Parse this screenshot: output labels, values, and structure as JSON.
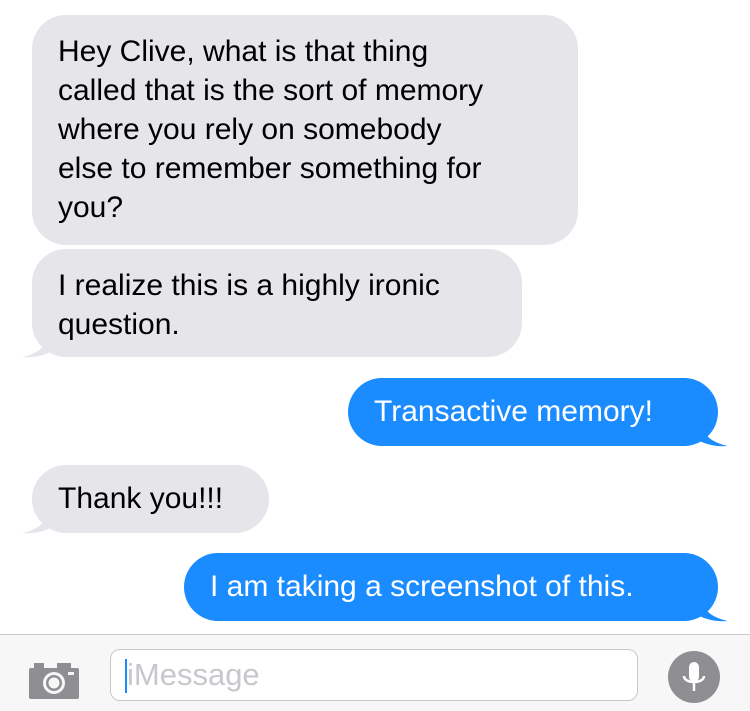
{
  "messages": [
    {
      "direction": "incoming",
      "text": "Hey Clive, what is that thing\ncalled that is the sort of memory\nwhere you rely on somebody\nelse to remember something for\nyou?"
    },
    {
      "direction": "incoming",
      "text": "I realize this is a highly ironic\nquestion."
    },
    {
      "direction": "outgoing",
      "text": "Transactive memory!"
    },
    {
      "direction": "incoming",
      "text": "Thank you!!!"
    },
    {
      "direction": "outgoing",
      "text": "I am taking a screenshot of this."
    }
  ],
  "composer": {
    "placeholder": "iMessage",
    "value": "",
    "camera_icon": "camera-icon",
    "mic_icon": "microphone-icon"
  },
  "colors": {
    "incoming_bubble": "#e5e5ea",
    "outgoing_bubble": "#1a8cff",
    "toolbar_bg": "#f7f7f8",
    "mic_button": "#8e8e93"
  }
}
